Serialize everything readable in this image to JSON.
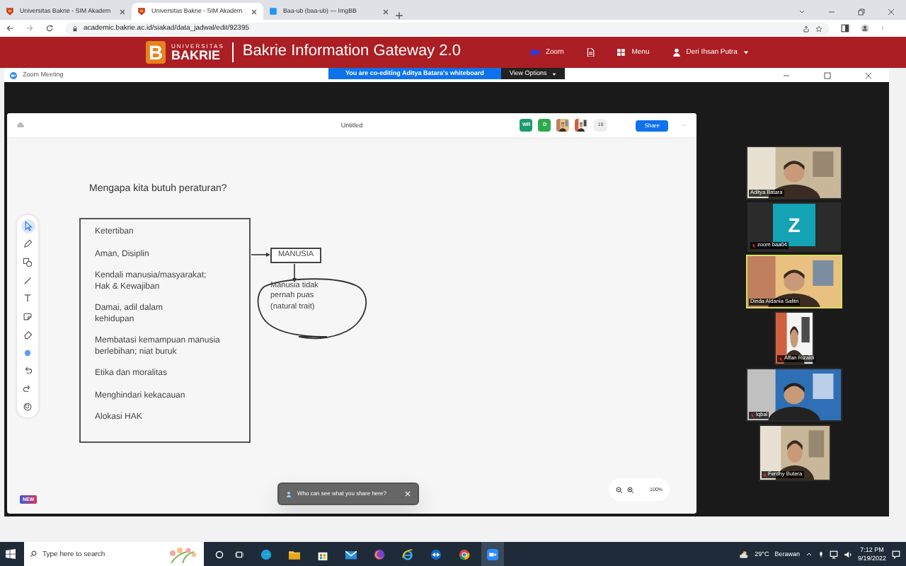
{
  "browser": {
    "tabs": [
      {
        "title": "Universitas Bakrie - SIM Akadem",
        "kind": "shield",
        "selected": false
      },
      {
        "title": "Universitas Bakrie - SIM Akadem",
        "kind": "shield",
        "selected": true
      },
      {
        "title": "Baa-ub (baa-ub) — ImgBB",
        "kind": "square",
        "selected": false
      }
    ],
    "url": "academic.bakrie.ac.id/siakad/data_jadwal/edit/92395"
  },
  "site_header": {
    "logo_mark": "B",
    "logo_top": "UNIVERSITAS",
    "logo_bottom": "BAKRIE",
    "title": "Bakrie Information Gateway 2.0",
    "nav": [
      {
        "kind": "video",
        "label": "Zoom"
      },
      {
        "kind": "document"
      },
      {
        "kind": "grid",
        "label": "Menu"
      },
      {
        "kind": "user",
        "label": "Deri Ihsan Putra"
      }
    ]
  },
  "zoom_window": {
    "title": "Zoom Meeting",
    "banner": "You are co-editing Aditya Batara's whiteboard",
    "view_options": "View Options"
  },
  "whiteboard": {
    "title": "Untitled",
    "collaborators": [
      {
        "kind": "initials",
        "initials": "WR",
        "color": "#1a9b72"
      },
      {
        "kind": "initials",
        "initials": "D",
        "color": "#2eaa4f"
      },
      {
        "kind": "picture"
      },
      {
        "kind": "picture"
      }
    ],
    "count": "18",
    "share": "Share",
    "tools": [
      {
        "kind": "select",
        "selected": true
      },
      {
        "kind": "pen",
        "selected": false
      },
      {
        "kind": "shapes",
        "selected": false
      },
      {
        "kind": "line",
        "selected": false
      },
      {
        "kind": "text",
        "selected": false
      },
      {
        "kind": "sticky",
        "selected": false
      },
      {
        "kind": "eraser",
        "selected": false
      },
      {
        "kind": "color",
        "selected": false
      },
      {
        "kind": "undo",
        "selected": false
      },
      {
        "kind": "redo",
        "selected": false
      },
      {
        "kind": "templates",
        "selected": false
      }
    ],
    "question": "Mengapa kita butuh peraturan?",
    "list_items": [
      "Ketertiban",
      "Aman, Disiplin",
      "Kendali manusia/masyarakat;\nHak & Kewajiban",
      "Damai, adil dalam\nkehidupan",
      "Membatasi kemampuan manusia\nberlebihan; niat buruk",
      "Etika dan moralitas",
      "Menghindari kekacauan",
      "Alokasi HAK"
    ],
    "box_label": "MANUSIA",
    "note": "Manusia tidak\npernah puas\n(natural trait)",
    "new_badge": "NEW",
    "toast": "Who can see what you share here?",
    "zoom_level": "100%"
  },
  "participants": [
    {
      "kind": "video",
      "name": "Aditya Batara",
      "muted": false,
      "speaking": false
    },
    {
      "kind": "avatar",
      "initial": "Z",
      "name": "zoom baa04",
      "muted": true,
      "speaking": false
    },
    {
      "kind": "video",
      "name": "Dinda Aldania Safitri",
      "muted": false,
      "speaking": true
    },
    {
      "kind": "portrait",
      "name": "Affan Rizaldi",
      "muted": true,
      "speaking": false
    },
    {
      "kind": "video",
      "name": "Iqbal",
      "muted": true,
      "speaking": false
    },
    {
      "kind": "narrow",
      "name": "Ferdhy Butera",
      "muted": true,
      "speaking": false
    }
  ],
  "taskbar": {
    "search_placeholder": "Type here to search",
    "apps": [
      {
        "kind": "edge",
        "selected": false
      },
      {
        "kind": "folder",
        "selected": false
      },
      {
        "kind": "store",
        "selected": false
      },
      {
        "kind": "mail",
        "selected": false
      },
      {
        "kind": "firefox",
        "selected": false
      },
      {
        "kind": "ie",
        "selected": false
      },
      {
        "kind": "remote",
        "selected": false
      },
      {
        "kind": "chrome",
        "selected": false
      },
      {
        "kind": "zoom",
        "selected": true
      }
    ],
    "temperature": "29°C",
    "weather": "Berawan",
    "time": "7:12 PM",
    "date": "9/19/2022"
  }
}
